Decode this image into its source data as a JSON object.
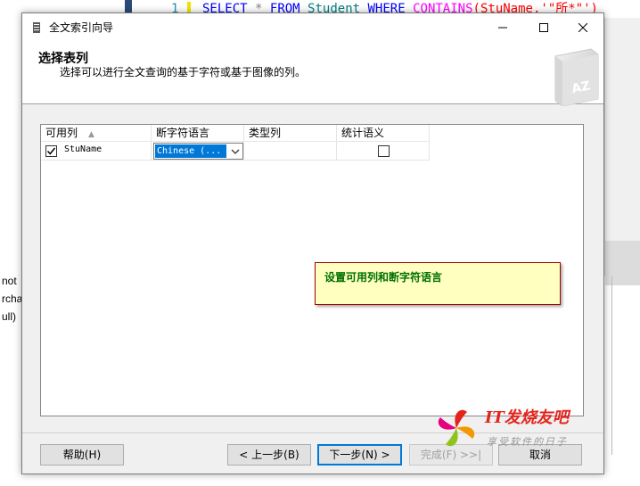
{
  "editor": {
    "line_number": "1",
    "code": {
      "select": "SELECT",
      "star": "*",
      "from": "FROM",
      "table": "Student",
      "where": "WHERE",
      "contains": "CONTAINS",
      "args": "(StuName,'\"所*\"')"
    },
    "left_fragments": [
      "not",
      "rcha",
      "ull)"
    ]
  },
  "dialog": {
    "title": "全文索引向导",
    "header": {
      "title": "选择表列",
      "subtitle": "选择可以进行全文查询的基于字符或基于图像的列。"
    },
    "grid": {
      "columns": [
        "可用列",
        "断字符语言",
        "类型列",
        "统计语义"
      ],
      "rows": [
        {
          "checked": true,
          "name": "StuName",
          "language": "Chinese (...",
          "type_column": "",
          "statistical_semantics": false
        }
      ]
    },
    "tooltip": "设置可用列和断字符语言",
    "buttons": {
      "help": "帮助(H)",
      "prev": "< 上一步(B)",
      "next": "下一步(N) >",
      "finish": "完成(F) >>|",
      "cancel": "取消"
    }
  },
  "watermark": {
    "title": "IT发烧友吧",
    "subtitle": "享受软件的日子"
  },
  "colors": {
    "selection": "#0078d7",
    "tooltip_bg": "#ffffc0",
    "tooltip_text": "#007000",
    "watermark_red": "#e4231b"
  }
}
